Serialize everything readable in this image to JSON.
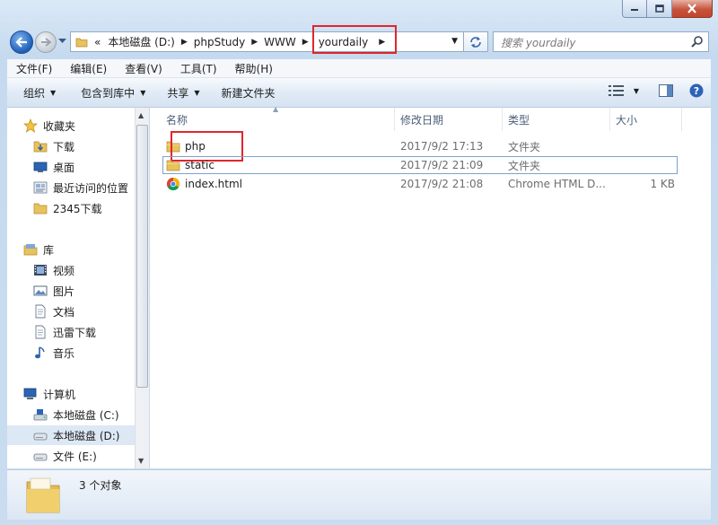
{
  "address": {
    "overflow": "«",
    "segments": [
      "本地磁盘 (D:)",
      "phpStudy",
      "WWW",
      "yourdaily"
    ]
  },
  "search": {
    "placeholder": "搜索 yourdaily"
  },
  "menu": [
    "文件(F)",
    "编辑(E)",
    "查看(V)",
    "工具(T)",
    "帮助(H)"
  ],
  "toolbar": {
    "organize": "组织",
    "include": "包含到库中",
    "share": "共享",
    "new_folder": "新建文件夹"
  },
  "nav": {
    "favorites": {
      "label": "收藏夹",
      "items": [
        "下载",
        "桌面",
        "最近访问的位置",
        "2345下载"
      ]
    },
    "libraries": {
      "label": "库",
      "items": [
        "视频",
        "图片",
        "文档",
        "迅雷下载",
        "音乐"
      ]
    },
    "computer": {
      "label": "计算机",
      "items": [
        "本地磁盘 (C:)",
        "本地磁盘 (D:)",
        "文件 (E:)"
      ]
    }
  },
  "columns": {
    "name": "名称",
    "date": "修改日期",
    "type": "类型",
    "size": "大小"
  },
  "files": [
    {
      "name": "php",
      "date": "2017/9/2 17:13",
      "type": "文件夹",
      "size": "",
      "icon": "folder-icon"
    },
    {
      "name": "static",
      "date": "2017/9/2 21:09",
      "type": "文件夹",
      "size": "",
      "icon": "folder-icon"
    },
    {
      "name": "index.html",
      "date": "2017/9/2 21:08",
      "type": "Chrome HTML D...",
      "size": "1 KB",
      "icon": "chrome-icon"
    }
  ],
  "status": {
    "count": "3 个对象"
  },
  "colors": {
    "highlight": "#e0262b",
    "selection": "#dde8f5",
    "chrome": "#c9dcf0"
  }
}
